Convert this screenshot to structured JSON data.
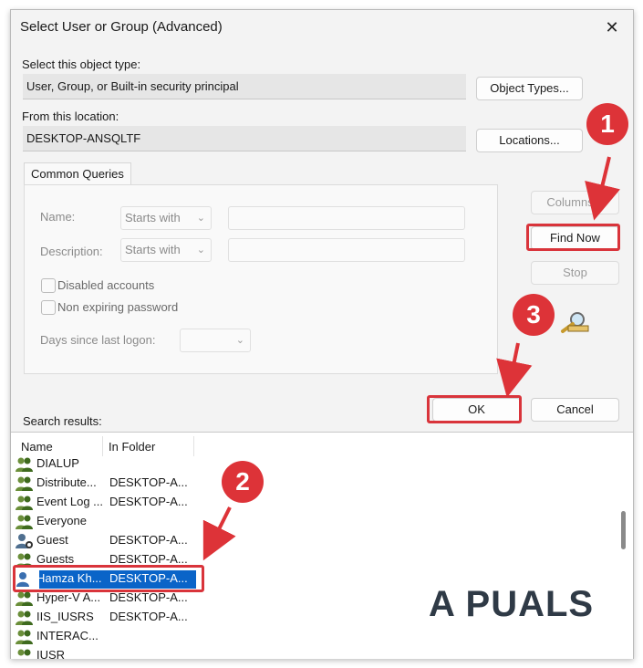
{
  "window": {
    "title": "Select User or Group (Advanced)",
    "close_glyph": "✕"
  },
  "object_type": {
    "label": "Select this object type:",
    "value": "User, Group, or Built-in security principal",
    "button": "Object Types..."
  },
  "location": {
    "label": "From this location:",
    "value": "DESKTOP-ANSQLTF",
    "button": "Locations..."
  },
  "queries": {
    "tab": "Common Queries",
    "name_label": "Name:",
    "name_mode": "Starts with",
    "description_label": "Description:",
    "description_mode": "Starts with",
    "disabled_accounts": "Disabled accounts",
    "non_expiring": "Non expiring password",
    "days_label": "Days since last logon:"
  },
  "side_buttons": {
    "columns": "Columns...",
    "find_now": "Find Now",
    "stop": "Stop"
  },
  "dialog_buttons": {
    "ok": "OK",
    "cancel": "Cancel"
  },
  "results": {
    "label": "Search results:",
    "columns": [
      "Name",
      "In Folder"
    ],
    "rows": [
      {
        "name": "DIALUP",
        "folder": "",
        "icon": "group-icon"
      },
      {
        "name": "Distribute...",
        "folder": "DESKTOP-A...",
        "icon": "group-icon"
      },
      {
        "name": "Event Log ...",
        "folder": "DESKTOP-A...",
        "icon": "group-icon"
      },
      {
        "name": "Everyone",
        "folder": "",
        "icon": "group-icon"
      },
      {
        "name": "Guest",
        "folder": "DESKTOP-A...",
        "icon": "user-icon"
      },
      {
        "name": "Guests",
        "folder": "DESKTOP-A...",
        "icon": "group-icon"
      },
      {
        "name": "Hamza Kh...",
        "folder": "DESKTOP-A...",
        "icon": "user-icon",
        "selected": true
      },
      {
        "name": "Hyper-V A...",
        "folder": "DESKTOP-A...",
        "icon": "group-icon"
      },
      {
        "name": "IIS_IUSRS",
        "folder": "DESKTOP-A...",
        "icon": "group-icon"
      },
      {
        "name": "INTERAC...",
        "folder": "",
        "icon": "group-icon"
      },
      {
        "name": "IUSR",
        "folder": "",
        "icon": "group-icon"
      }
    ]
  },
  "annotations": {
    "step1": "1",
    "step2": "2",
    "step3": "3",
    "color": "#dd3338"
  },
  "watermark": "A PUALS",
  "colors": {
    "selection": "#0a64c8",
    "highlight": "#d9343b"
  }
}
